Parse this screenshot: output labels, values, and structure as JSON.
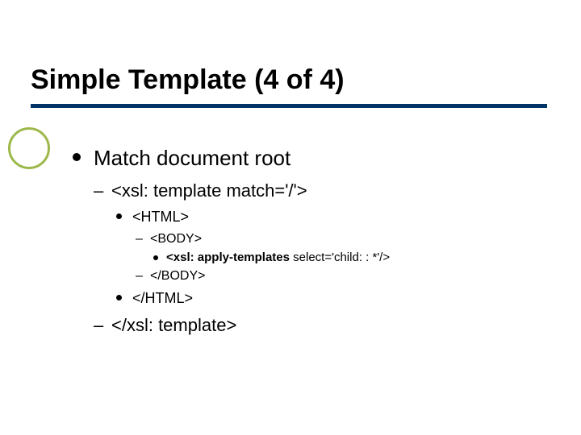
{
  "title": "Simple Template (4 of 4)",
  "bullets": {
    "l1": "Match document root",
    "l2a": "<xsl: template match='/'>",
    "l3a": "<HTML>",
    "l4a": "<BODY>",
    "l5a_strong": "<xsl: apply-templates ",
    "l5a_rest": "select='child: : *'/>",
    "l4b": "</BODY>",
    "l3b": "</HTML>",
    "l2b": "</xsl: template>"
  }
}
